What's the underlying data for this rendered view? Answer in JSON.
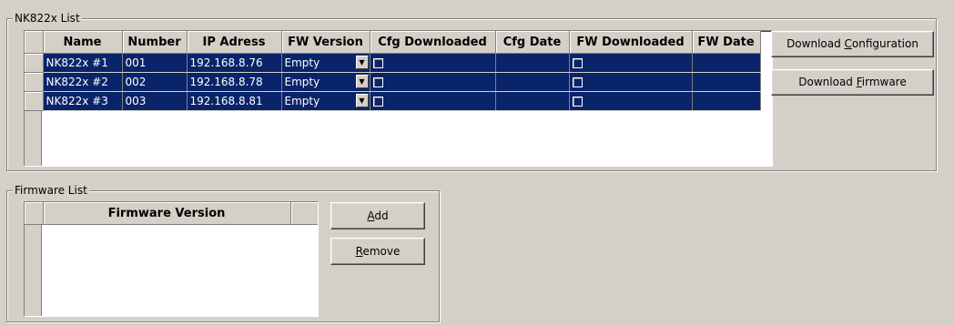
{
  "nk_group": {
    "title": "NK822x List",
    "columns": [
      "Name",
      "Number",
      "IP Adress",
      "FW Version",
      "Cfg Downloaded",
      "Cfg Date",
      "FW Downloaded",
      "FW Date"
    ],
    "rows": [
      {
        "name": "NK822x #1",
        "number": "001",
        "ip": "192.168.8.76",
        "fw_version": "Empty",
        "cfg_downloaded": false,
        "cfg_date": "",
        "fw_downloaded": false,
        "fw_date": ""
      },
      {
        "name": "NK822x #2",
        "number": "002",
        "ip": "192.168.8.78",
        "fw_version": "Empty",
        "cfg_downloaded": false,
        "cfg_date": "",
        "fw_downloaded": false,
        "fw_date": ""
      },
      {
        "name": "NK822x #3",
        "number": "003",
        "ip": "192.168.8.81",
        "fw_version": "Empty",
        "cfg_downloaded": false,
        "cfg_date": "",
        "fw_downloaded": false,
        "fw_date": ""
      }
    ],
    "buttons": {
      "download_cfg": {
        "pre": "Download ",
        "accel": "C",
        "post": "onfiguration"
      },
      "download_fw": {
        "pre": "Download ",
        "accel": "F",
        "post": "irmware"
      }
    }
  },
  "fw_group": {
    "title": "Firmware List",
    "columns": [
      "Firmware Version"
    ],
    "buttons": {
      "add": {
        "pre": "",
        "accel": "A",
        "post": "dd"
      },
      "remove": {
        "pre": "",
        "accel": "R",
        "post": "emove"
      }
    }
  },
  "colors": {
    "selection": "#0a246a",
    "face": "#d4d0c8"
  }
}
